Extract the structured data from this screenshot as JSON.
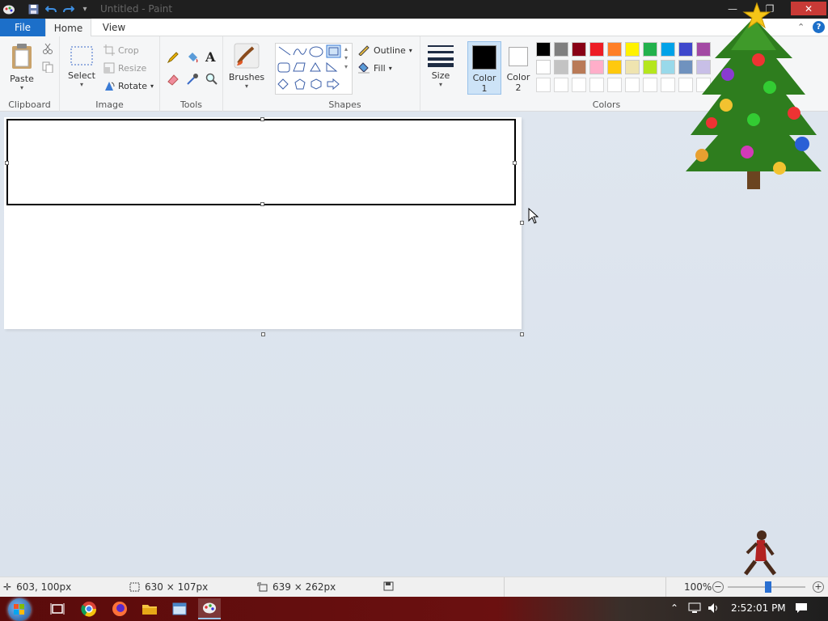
{
  "window": {
    "title": "Untitled - Paint",
    "minimize_glyph": "—",
    "maximize_glyph": "❐",
    "close_glyph": "✕"
  },
  "tabs": {
    "file": "File",
    "home": "Home",
    "view": "View"
  },
  "ribbon": {
    "clipboard": {
      "label": "Clipboard",
      "paste": "Paste"
    },
    "image": {
      "label": "Image",
      "select": "Select",
      "crop": "Crop",
      "resize": "Resize",
      "rotate": "Rotate"
    },
    "tools": {
      "label": "Tools"
    },
    "brushes": {
      "label": "Brushes"
    },
    "shapes": {
      "label": "Shapes",
      "outline": "Outline",
      "fill": "Fill"
    },
    "size": {
      "label": "Size"
    },
    "color1": {
      "line1": "Color",
      "line2": "1",
      "value": "#000000"
    },
    "color2": {
      "line1": "Color",
      "line2": "2",
      "value": "#ffffff"
    },
    "colors": {
      "label": "Colors",
      "row1": [
        "#000000",
        "#7f7f7f",
        "#880015",
        "#ed1c24",
        "#ff7f27",
        "#fff200",
        "#22b14c",
        "#00a2e8",
        "#3f48cc",
        "#a349a4"
      ],
      "row2": [
        "#ffffff",
        "#c3c3c3",
        "#b97a57",
        "#ffaec9",
        "#ffc90e",
        "#efe4b0",
        "#b5e61d",
        "#99d9ea",
        "#7092be",
        "#c8bfe7"
      ]
    }
  },
  "status": {
    "cursor_pos": "603, 100px",
    "selection_size": "630 × 107px",
    "canvas_size": "639 × 262px",
    "zoom": "100%"
  },
  "taskbar": {
    "clock": "2:52:01 PM"
  }
}
